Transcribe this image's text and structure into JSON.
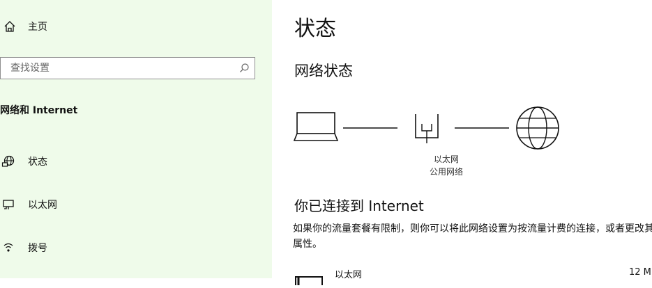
{
  "sidebar": {
    "home_label": "主页",
    "search": {
      "placeholder": "查找设置"
    },
    "section_title": "网络和 Internet",
    "items": [
      {
        "label": "状态",
        "icon": "globe-status-icon"
      },
      {
        "label": "以太网",
        "icon": "ethernet-icon"
      },
      {
        "label": "拨号",
        "icon": "dialup-icon"
      }
    ]
  },
  "main": {
    "title": "状态",
    "subtitle": "网络状态",
    "diagram": {
      "connection_type": "以太网",
      "network_profile": "公用网络"
    },
    "status_title": "你已连接到 Internet",
    "status_desc": "如果你的流量套餐有限制，则你可以将此网络设置为按流量计费的连接，或者更改其他属性。",
    "adapter": {
      "name": "以太网",
      "bytes": "12 M"
    }
  },
  "colors": {
    "sidebar_bg": "#effbea",
    "main_bg": "#ffffff",
    "text": "#111111"
  }
}
